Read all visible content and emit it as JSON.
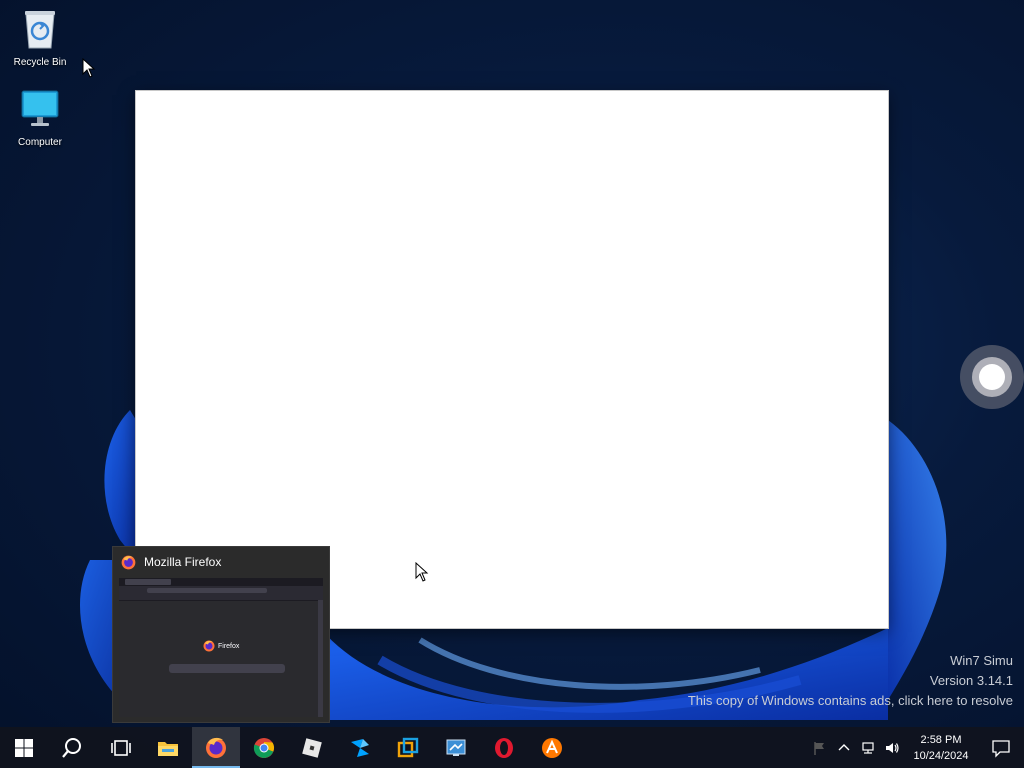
{
  "desktop": {
    "icons": [
      {
        "label": "Recycle Bin"
      },
      {
        "label": "Computer"
      }
    ]
  },
  "thumbnail": {
    "title": "Mozilla Firefox",
    "preview_brand": "Firefox"
  },
  "watermark": {
    "line1": "Win7 Simu",
    "line2": "Version 3.14.1",
    "line3": "This copy of Windows contains ads, click here to resolve"
  },
  "taskbar": {
    "apps": [
      {
        "icon": "start-icon"
      },
      {
        "icon": "search-icon"
      },
      {
        "icon": "task-view-icon"
      },
      {
        "icon": "file-explorer-icon"
      },
      {
        "icon": "firefox-icon",
        "active": true
      },
      {
        "icon": "chrome-icon"
      },
      {
        "icon": "roblox-icon"
      },
      {
        "icon": "roblox-studio-icon"
      },
      {
        "icon": "virtualbox-icon"
      },
      {
        "icon": "remote-desktop-icon"
      },
      {
        "icon": "opera-icon"
      },
      {
        "icon": "avast-icon"
      }
    ],
    "tray_icons": [
      "flag-icon",
      "chevron-up-icon",
      "network-icon",
      "volume-icon"
    ],
    "clock": {
      "time": "2:58 PM",
      "date": "10/24/2024"
    },
    "notification_icon": "notification-icon"
  },
  "colors": {
    "accent": "#76b9ed",
    "taskbar": "#10141e",
    "window": "#ffffff"
  }
}
